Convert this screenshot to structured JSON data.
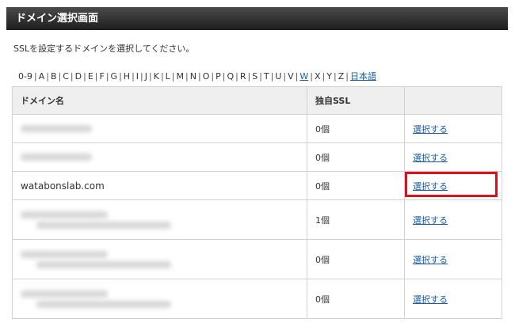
{
  "header": {
    "title": "ドメイン選択画面"
  },
  "intro": {
    "text": "SSLを設定するドメインを選択してください。"
  },
  "alpha_nav": {
    "items": [
      {
        "label": "0-9",
        "link": false
      },
      {
        "label": "A",
        "link": false
      },
      {
        "label": "B",
        "link": false
      },
      {
        "label": "C",
        "link": false
      },
      {
        "label": "D",
        "link": false
      },
      {
        "label": "E",
        "link": false
      },
      {
        "label": "F",
        "link": false
      },
      {
        "label": "G",
        "link": false
      },
      {
        "label": "H",
        "link": false
      },
      {
        "label": "I",
        "link": false
      },
      {
        "label": "J",
        "link": false
      },
      {
        "label": "K",
        "link": false
      },
      {
        "label": "L",
        "link": false
      },
      {
        "label": "M",
        "link": false
      },
      {
        "label": "N",
        "link": false
      },
      {
        "label": "O",
        "link": false
      },
      {
        "label": "P",
        "link": false
      },
      {
        "label": "Q",
        "link": false
      },
      {
        "label": "R",
        "link": false
      },
      {
        "label": "S",
        "link": false
      },
      {
        "label": "T",
        "link": false
      },
      {
        "label": "U",
        "link": false
      },
      {
        "label": "V",
        "link": false
      },
      {
        "label": "W",
        "link": true
      },
      {
        "label": "X",
        "link": false
      },
      {
        "label": "Y",
        "link": false
      },
      {
        "label": "Z",
        "link": false
      },
      {
        "label": "日本語",
        "link": true
      }
    ],
    "separator": "|"
  },
  "table": {
    "columns": {
      "domain": "ドメイン名",
      "ssl": "独自SSL",
      "action": ""
    },
    "rows": [
      {
        "domain": "",
        "blurred": true,
        "ssl": "0個",
        "action": "選択する"
      },
      {
        "domain": "",
        "blurred": true,
        "ssl": "0個",
        "action": "選択する"
      },
      {
        "domain": "watabonslab.com",
        "blurred": false,
        "ssl": "0個",
        "action": "選択する",
        "highlighted": true
      },
      {
        "domain": "",
        "blurred": true,
        "ssl": "1個",
        "action": "選択する"
      },
      {
        "domain": "",
        "blurred": true,
        "ssl": "0個",
        "action": "選択する"
      },
      {
        "domain": "",
        "blurred": true,
        "ssl": "0個",
        "action": "選択する"
      }
    ]
  },
  "colors": {
    "header_bg": "#1e1e1e",
    "link": "#1a5da8",
    "highlight": "#e0101a"
  }
}
